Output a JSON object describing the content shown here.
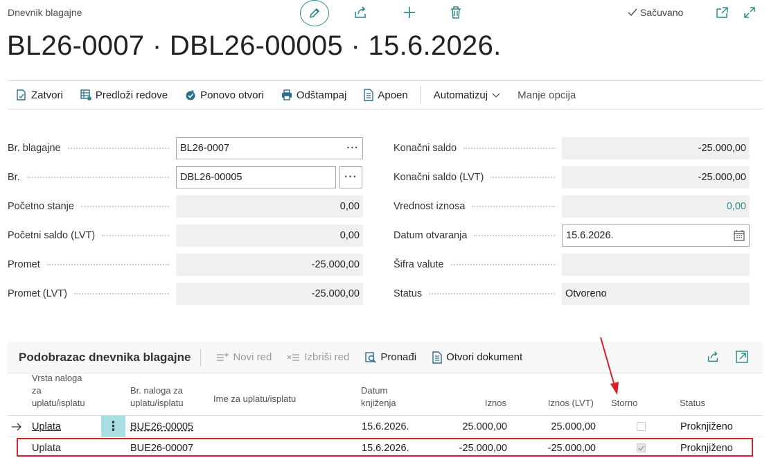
{
  "header": {
    "caption": "Dnevnik blagajne",
    "title": "BL26-0007 · DBL26-00005 · 15.6.2026.",
    "saved_label": "Sačuvano"
  },
  "actions": {
    "close": "Zatvori",
    "suggest_lines": "Predloži redove",
    "reopen": "Ponovo otvori",
    "print": "Odštampaj",
    "denomination": "Apoen",
    "automate": "Automatizuj",
    "fewer_options": "Manje opcija"
  },
  "form": {
    "left": [
      {
        "label": "Br. blagajne",
        "value": "BL26-0007"
      },
      {
        "label": "Br.",
        "value": "DBL26-00005"
      },
      {
        "label": "Početno stanje",
        "value": "0,00"
      },
      {
        "label": "Početni saldo (LVT)",
        "value": "0,00"
      },
      {
        "label": "Promet",
        "value": "-25.000,00"
      },
      {
        "label": "Promet (LVT)",
        "value": "-25.000,00"
      }
    ],
    "right": [
      {
        "label": "Konačni saldo",
        "value": "-25.000,00"
      },
      {
        "label": "Konačni saldo (LVT)",
        "value": "-25.000,00"
      },
      {
        "label": "Vrednost iznosa",
        "value": "0,00"
      },
      {
        "label": "Datum otvaranja",
        "value": "15.6.2026."
      },
      {
        "label": "Šifra valute",
        "value": ""
      },
      {
        "label": "Status",
        "value": "Otvoreno"
      }
    ],
    "lookup_glyph": "···"
  },
  "subpage": {
    "title": "Podobrazac dnevnika blagajne",
    "actions": {
      "new_line": "Novi red",
      "delete_line": "Izbriši red",
      "find": "Pronađi",
      "open_document": "Otvori dokument"
    },
    "columns": {
      "order_type": [
        "Vrsta naloga",
        "za",
        "uplatu/isplatu"
      ],
      "order_no": [
        "Br. naloga za",
        "uplatu/isplatu"
      ],
      "order_name": [
        "Ime za uplatu/isplatu"
      ],
      "posting_date": [
        "Datum",
        "knjiženja"
      ],
      "amount": [
        "Iznos"
      ],
      "amount_lvt": [
        "Iznos (LVT)"
      ],
      "reversal": [
        "Storno"
      ],
      "status": [
        "Status"
      ]
    },
    "rows": [
      {
        "type": "Uplata",
        "no": "BUE26-00005",
        "name": "",
        "date": "15.6.2026.",
        "amount": "25.000,00",
        "amount_lvt": "25.000,00",
        "reversal": false,
        "status": "Proknjiženo"
      },
      {
        "type": "Uplata",
        "no": "BUE26-00007",
        "name": "",
        "date": "15.6.2026.",
        "amount": "-25.000,00",
        "amount_lvt": "-25.000,00",
        "reversal": true,
        "status": "Proknjiženo"
      }
    ]
  },
  "colors": {
    "accent": "#2b8b8b",
    "annotation": "#d81e2a",
    "row_menu": "#a8dfe0"
  }
}
